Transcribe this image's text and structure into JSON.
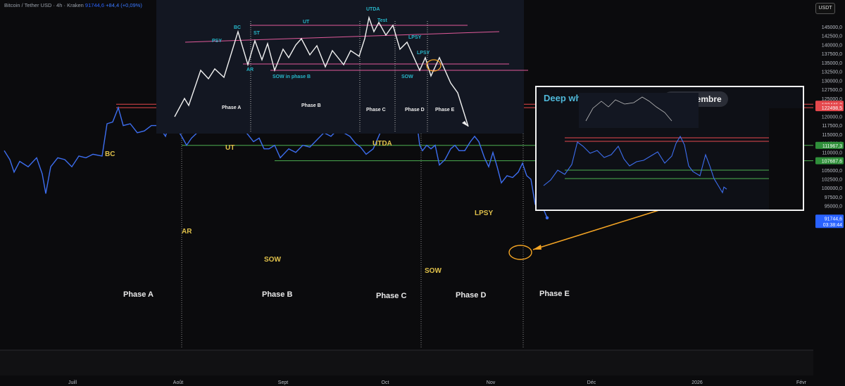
{
  "header": {
    "symbol": "Bitcoin / Tether USD · 4h · Kraken",
    "price": "91744,6",
    "change": "+84,4 (+0,09%)"
  },
  "currency": "USDT",
  "y_axis_ticks": [
    "145000,0",
    "142500,0",
    "140000,0",
    "137500,0",
    "135000,0",
    "132500,0",
    "130000,0",
    "127500,0",
    "125000,0",
    "122500,0",
    "120000,0",
    "117500,0",
    "115000,0",
    "112500,0",
    "110000,0",
    "107500,0",
    "105000,0",
    "102500,0",
    "100000,0",
    "97500,0",
    "95000,0"
  ],
  "x_axis_ticks": [
    "Juill",
    "Août",
    "Sept",
    "Oct",
    "Nov",
    "Déc",
    "2026",
    "Févr"
  ],
  "price_badges": [
    {
      "value": "123446,3",
      "color": "#e5484d"
    },
    {
      "value": "122498,5",
      "color": "#e5484d"
    },
    {
      "value": "111967,3",
      "color": "#2f8f3a"
    },
    {
      "value": "107687,6",
      "color": "#2f8f3a"
    }
  ],
  "last_price_badge": {
    "price": "91744,6",
    "countdown": "03:38:44",
    "color": "#2962ff"
  },
  "wyckoff_labels": [
    "BC",
    "UT",
    "UTDA",
    "LPSY",
    "AR",
    "SOW",
    "SOW"
  ],
  "phase_labels": [
    "Phase A",
    "Phase B",
    "Phase C",
    "Phase D",
    "Phase E"
  ],
  "schematic": {
    "labels": [
      "PSY",
      "BC",
      "ST",
      "AR",
      "UT",
      "SOW in phase B",
      "UTDA",
      "Test",
      "LPSY",
      "LPSY",
      "SOW"
    ],
    "phases": [
      "Phase A",
      "Phase B",
      "Phase C",
      "Phase D",
      "Phase E"
    ]
  },
  "inset": {
    "title": "Deep whale - Club",
    "date": "11 novembre"
  },
  "colors": {
    "price_line": "#3d6ef0",
    "resistance": "#e5484d",
    "support": "#4caf50",
    "annotation": "#f5a524",
    "wyckoff_text": "#e0c14a"
  },
  "chart_data": {
    "type": "line",
    "title": "Bitcoin / Tether USD · 4h · Kraken",
    "ylim": [
      91000,
      147500
    ],
    "x_ticks": [
      "Juill",
      "Août",
      "Sept",
      "Oct",
      "Nov",
      "Déc",
      "2026",
      "Févr"
    ],
    "series": [
      {
        "values": [
          [
            6,
            110500
          ],
          [
            14,
            108000
          ],
          [
            20,
            104500
          ],
          [
            28,
            107500
          ],
          [
            40,
            106000
          ],
          [
            52,
            108500
          ],
          [
            60,
            104000
          ],
          [
            65,
            98500
          ],
          [
            72,
            106000
          ],
          [
            82,
            108500
          ],
          [
            92,
            108000
          ],
          [
            102,
            106000
          ],
          [
            112,
            109000
          ],
          [
            122,
            108500
          ],
          [
            132,
            109500
          ],
          [
            145,
            109000
          ],
          [
            152,
            118000
          ],
          [
            160,
            118500
          ],
          [
            168,
            122500
          ],
          [
            175,
            117500
          ],
          [
            185,
            118000
          ],
          [
            195,
            115500
          ],
          [
            205,
            116000
          ],
          [
            215,
            117500
          ],
          [
            225,
            117500
          ],
          [
            235,
            114500
          ],
          [
            242,
            119000
          ],
          [
            250,
            117000
          ],
          [
            258,
            114500
          ],
          [
            265,
            112000
          ],
          [
            272,
            114000
          ],
          [
            280,
            115500
          ],
          [
            290,
            117000
          ],
          [
            302,
            123000
          ],
          [
            309,
            117000
          ],
          [
            316,
            123800
          ],
          [
            322,
            120000
          ],
          [
            330,
            119000
          ],
          [
            338,
            118000
          ],
          [
            345,
            116500
          ],
          [
            352,
            115000
          ],
          [
            360,
            113000
          ],
          [
            368,
            114000
          ],
          [
            375,
            111000
          ],
          [
            382,
            111000
          ],
          [
            390,
            112000
          ],
          [
            398,
            108500
          ],
          [
            410,
            111000
          ],
          [
            420,
            110000
          ],
          [
            430,
            112000
          ],
          [
            440,
            111500
          ],
          [
            450,
            113500
          ],
          [
            460,
            115500
          ],
          [
            470,
            114500
          ],
          [
            480,
            116500
          ],
          [
            488,
            115500
          ],
          [
            497,
            114500
          ],
          [
            505,
            112500
          ],
          [
            512,
            111500
          ],
          [
            520,
            109500
          ],
          [
            530,
            111000
          ],
          [
            540,
            115500
          ],
          [
            548,
            118000
          ],
          [
            556,
            121000
          ],
          [
            563,
            123500
          ],
          [
            572,
            124800
          ],
          [
            577,
            122500
          ],
          [
            583,
            123000
          ],
          [
            590,
            121500
          ],
          [
            596,
            112000
          ],
          [
            600,
            110500
          ],
          [
            606,
            112000
          ],
          [
            612,
            111000
          ],
          [
            618,
            112000
          ],
          [
            624,
            106500
          ],
          [
            632,
            108000
          ],
          [
            640,
            111000
          ],
          [
            646,
            112000
          ],
          [
            652,
            110500
          ],
          [
            660,
            110500
          ],
          [
            668,
            113000
          ],
          [
            674,
            114500
          ],
          [
            680,
            113000
          ],
          [
            688,
            108500
          ],
          [
            694,
            106000
          ],
          [
            700,
            110000
          ],
          [
            706,
            106000
          ],
          [
            712,
            101500
          ],
          [
            720,
            103500
          ],
          [
            728,
            103000
          ],
          [
            736,
            104500
          ],
          [
            742,
            107000
          ],
          [
            748,
            103500
          ],
          [
            754,
            102500
          ],
          [
            760,
            95500
          ],
          [
            770,
            95000
          ],
          [
            777,
            91744
          ]
        ]
      }
    ],
    "horizontal_levels": [
      123446.3,
      122498.5,
      111967.3,
      107687.6
    ]
  }
}
